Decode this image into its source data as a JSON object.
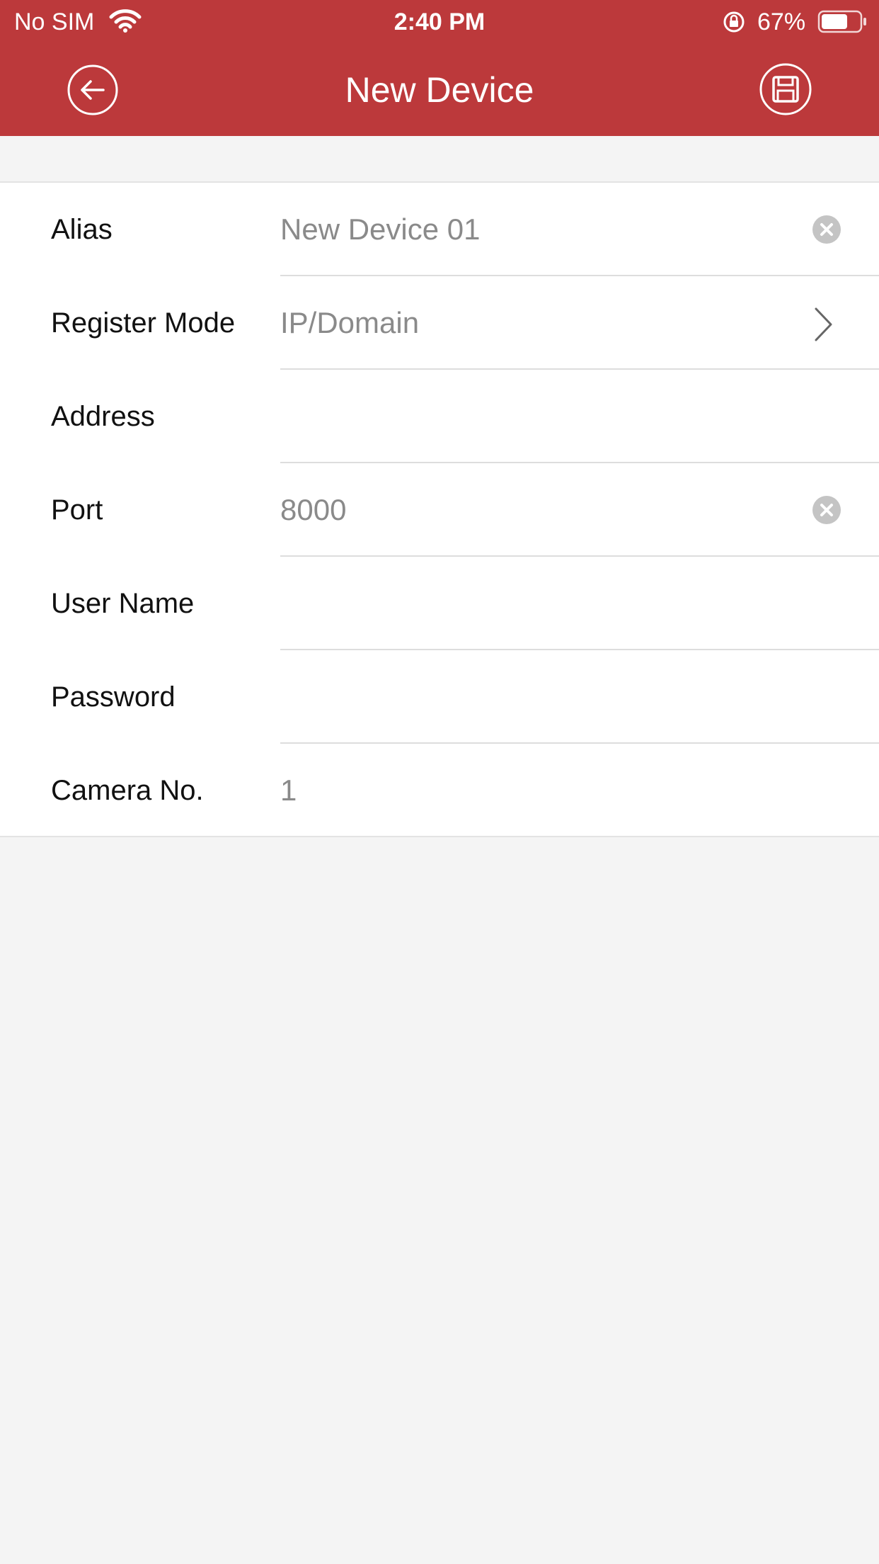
{
  "status_bar": {
    "carrier": "No SIM",
    "time": "2:40 PM",
    "battery": "67%"
  },
  "nav": {
    "title": "New Device",
    "back_icon": "back-arrow-icon",
    "save_icon": "save-icon"
  },
  "form": {
    "alias": {
      "label": "Alias",
      "value": "New Device 01"
    },
    "register_mode": {
      "label": "Register Mode",
      "value": "IP/Domain"
    },
    "address": {
      "label": "Address",
      "value": ""
    },
    "port": {
      "label": "Port",
      "value": "8000"
    },
    "user_name": {
      "label": "User Name",
      "value": ""
    },
    "password": {
      "label": "Password",
      "value": ""
    },
    "camera_no": {
      "label": "Camera No.",
      "value": "1"
    }
  },
  "colors": {
    "header": "#bc393b",
    "background": "#f4f4f4",
    "value_text": "#8a8a8a"
  }
}
